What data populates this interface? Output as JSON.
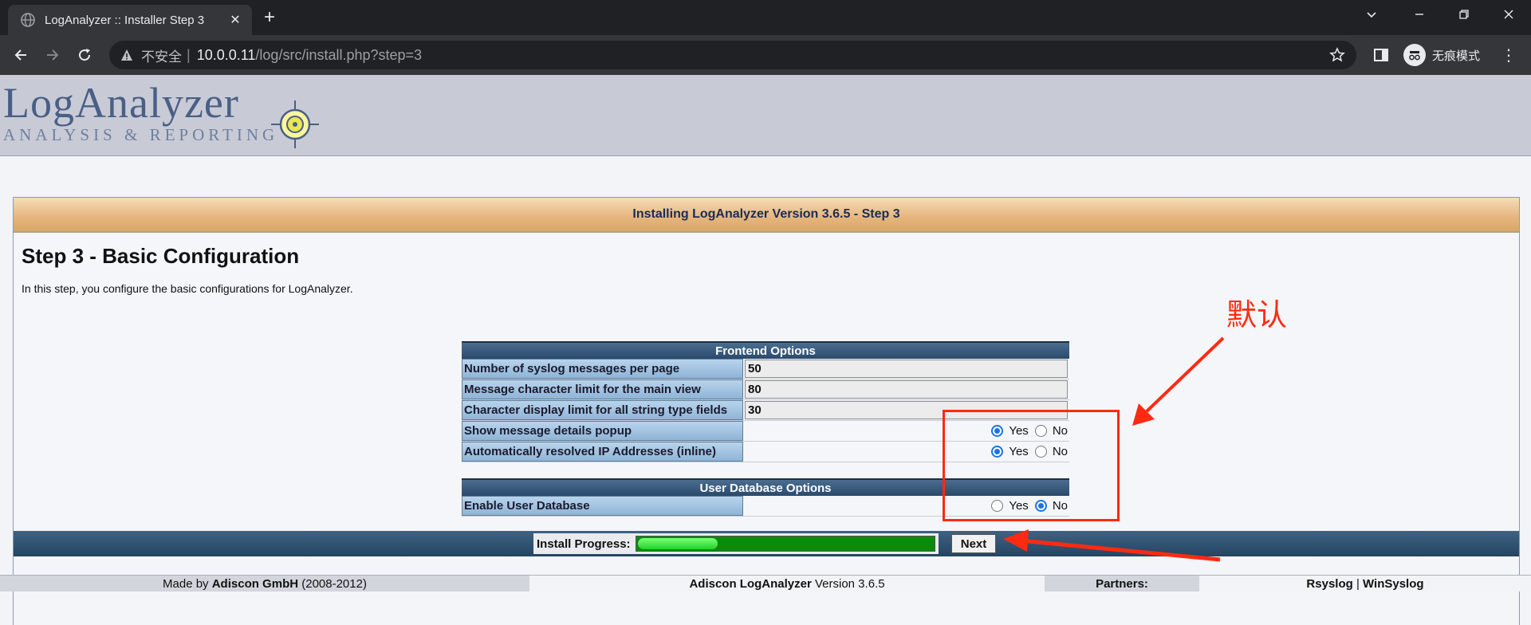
{
  "browser": {
    "tab_title": "LogAnalyzer :: Installer Step 3",
    "url_insecure_label": "不安全",
    "url_host": "10.0.0.11",
    "url_path": "/log/src/install.php?step=3",
    "incognito_label": "无痕模式"
  },
  "header": {
    "logo_main": "LogAnalyzer",
    "logo_sub": "ANALYSIS & REPORTING"
  },
  "page": {
    "title_bar": "Installing LogAnalyzer Version 3.6.5 - Step 3",
    "heading": "Step 3 - Basic Configuration",
    "description": "In this step, you configure the basic configurations for LogAnalyzer."
  },
  "frontend": {
    "section_title": "Frontend Options",
    "syslog_per_page_label": "Number of syslog messages per page",
    "syslog_per_page_value": "50",
    "char_limit_label": "Message character limit for the main view",
    "char_limit_value": "80",
    "string_limit_label": "Character display limit for all string type fields",
    "string_limit_value": "30",
    "details_popup_label": "Show message details popup",
    "details_popup_selected": "Yes",
    "resolve_ip_label": "Automatically resolved IP Addresses (inline)",
    "resolve_ip_selected": "Yes"
  },
  "userdb": {
    "section_title": "User Database Options",
    "enable_label": "Enable User Database",
    "enable_selected": "No"
  },
  "radio": {
    "yes": "Yes",
    "no": "No"
  },
  "progress": {
    "label": "Install Progress:",
    "fraction": 0.27,
    "next_label": "Next"
  },
  "footer": {
    "made_by_prefix": "Made by ",
    "made_by_company": "Adiscon GmbH",
    "made_by_years": " (2008-2012)",
    "product_name": "Adiscon LogAnalyzer",
    "product_version": " Version 3.6.5",
    "partners_label": "Partners:",
    "partner_1": "Rsyslog",
    "partner_sep": " | ",
    "partner_2": "WinSyslog"
  },
  "annotation": {
    "text": "默认",
    "color": "#ff2a12"
  }
}
